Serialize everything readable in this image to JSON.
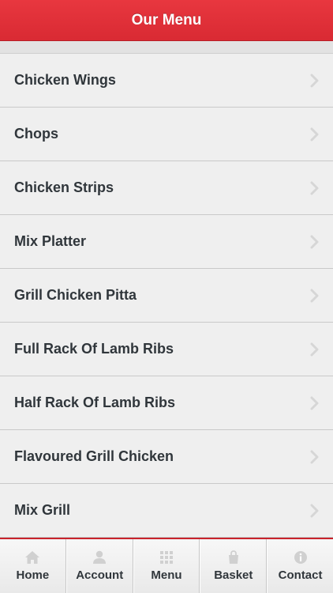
{
  "header": {
    "title": "Our Menu"
  },
  "menu": {
    "items": [
      {
        "label": "Chicken Wings"
      },
      {
        "label": "Chops"
      },
      {
        "label": "Chicken Strips"
      },
      {
        "label": "Mix Platter"
      },
      {
        "label": "Grill Chicken Pitta"
      },
      {
        "label": "Full Rack Of Lamb Ribs"
      },
      {
        "label": "Half Rack Of Lamb Ribs"
      },
      {
        "label": "Flavoured Grill Chicken"
      },
      {
        "label": "Mix Grill"
      }
    ],
    "row_icon": "chevron-right-icon"
  },
  "tabbar": {
    "tabs": [
      {
        "label": "Home",
        "icon": "home-icon"
      },
      {
        "label": "Account",
        "icon": "user-icon"
      },
      {
        "label": "Menu",
        "icon": "grid-icon"
      },
      {
        "label": "Basket",
        "icon": "bag-icon"
      },
      {
        "label": "Contact",
        "icon": "info-icon"
      }
    ]
  },
  "colors": {
    "brand_red": "#d92a33",
    "background": "#efefef",
    "text": "#30363b",
    "icon_gray": "#d0d0d0"
  }
}
